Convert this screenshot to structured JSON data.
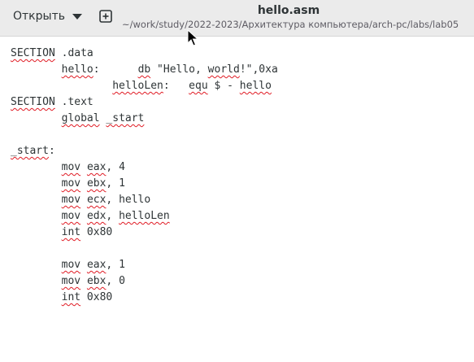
{
  "header": {
    "open_label": "Открыть",
    "title": "hello.asm",
    "subtitle": "~/work/study/2022-2023/Архитектура компьютера/arch-pc/labs/lab05"
  },
  "editor": {
    "lines": [
      [
        {
          "t": "SECTION",
          "s": true
        },
        {
          "t": " .data",
          "s": false
        }
      ],
      [
        {
          "t": "        ",
          "s": false
        },
        {
          "t": "hello",
          "s": true
        },
        {
          "t": ":      ",
          "s": false
        },
        {
          "t": "db",
          "s": true
        },
        {
          "t": " \"Hello, ",
          "s": false
        },
        {
          "t": "world",
          "s": true
        },
        {
          "t": "!\",0xa",
          "s": false
        }
      ],
      [
        {
          "t": "                ",
          "s": false
        },
        {
          "t": "helloLen",
          "s": true
        },
        {
          "t": ":   ",
          "s": false
        },
        {
          "t": "equ",
          "s": true
        },
        {
          "t": " $ - ",
          "s": false
        },
        {
          "t": "hello",
          "s": true
        }
      ],
      [
        {
          "t": "SECTION",
          "s": true
        },
        {
          "t": " .text",
          "s": false
        }
      ],
      [
        {
          "t": "        ",
          "s": false
        },
        {
          "t": "global",
          "s": true
        },
        {
          "t": " ",
          "s": false
        },
        {
          "t": "_start",
          "s": true
        }
      ],
      [],
      [
        {
          "t": "_start",
          "s": true
        },
        {
          "t": ":",
          "s": false
        }
      ],
      [
        {
          "t": "        ",
          "s": false
        },
        {
          "t": "mov",
          "s": true
        },
        {
          "t": " ",
          "s": false
        },
        {
          "t": "eax",
          "s": true
        },
        {
          "t": ", 4",
          "s": false
        }
      ],
      [
        {
          "t": "        ",
          "s": false
        },
        {
          "t": "mov",
          "s": true
        },
        {
          "t": " ",
          "s": false
        },
        {
          "t": "ebx",
          "s": true
        },
        {
          "t": ", 1",
          "s": false
        }
      ],
      [
        {
          "t": "        ",
          "s": false
        },
        {
          "t": "mov",
          "s": true
        },
        {
          "t": " ",
          "s": false
        },
        {
          "t": "ecx",
          "s": true
        },
        {
          "t": ", hello",
          "s": false
        }
      ],
      [
        {
          "t": "        ",
          "s": false
        },
        {
          "t": "mov",
          "s": true
        },
        {
          "t": " ",
          "s": false
        },
        {
          "t": "edx",
          "s": true
        },
        {
          "t": ", ",
          "s": false
        },
        {
          "t": "helloLen",
          "s": true
        }
      ],
      [
        {
          "t": "        ",
          "s": false
        },
        {
          "t": "int",
          "s": true
        },
        {
          "t": " 0x80",
          "s": false
        }
      ],
      [],
      [
        {
          "t": "        ",
          "s": false
        },
        {
          "t": "mov",
          "s": true
        },
        {
          "t": " ",
          "s": false
        },
        {
          "t": "eax",
          "s": true
        },
        {
          "t": ", 1",
          "s": false
        }
      ],
      [
        {
          "t": "        ",
          "s": false
        },
        {
          "t": "mov",
          "s": true
        },
        {
          "t": " ",
          "s": false
        },
        {
          "t": "ebx",
          "s": true
        },
        {
          "t": ", 0",
          "s": false
        }
      ],
      [
        {
          "t": "        ",
          "s": false
        },
        {
          "t": "int",
          "s": true
        },
        {
          "t": " 0x80",
          "s": false
        }
      ]
    ]
  },
  "icons": {
    "open_menu": "chevron-down-icon",
    "new_tab": "new-tab-icon",
    "pointer": "mouse-pointer-icon"
  },
  "colors": {
    "headerbar": "#ebebeb",
    "spellcheck_underline": "#e01b24",
    "text": "#2e3436"
  }
}
